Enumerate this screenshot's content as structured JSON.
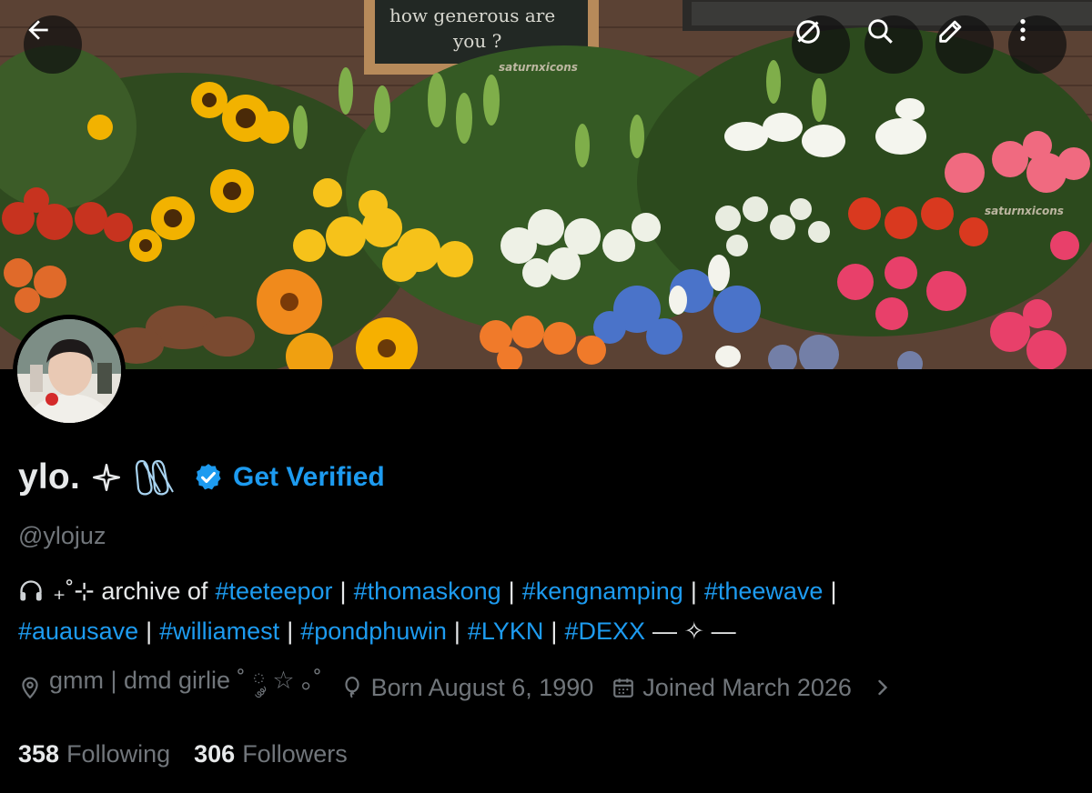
{
  "banner": {
    "chalkboard_text": [
      "how generous are",
      "you ?"
    ],
    "watermark": "saturnxicons"
  },
  "toolbar": {
    "back_icon": "arrow-left-icon",
    "items": [
      {
        "icon": "no-eye-icon"
      },
      {
        "icon": "search-icon"
      },
      {
        "icon": "edit-icon"
      },
      {
        "icon": "more-vertical-icon"
      }
    ]
  },
  "profile": {
    "display_name": "ylo.",
    "name_symbol": "✧",
    "get_verified_label": "Get Verified",
    "handle": "@ylojuz",
    "bio": {
      "line1_prefix": "₊˚⊹ archive of",
      "line1_tags": [
        "#teeteepor",
        "#thomaskong",
        "#kengnamping",
        "#theewave"
      ],
      "line2_tags": [
        "#auausave",
        "#williamest",
        "#pondphuwin",
        "#LYKN",
        "#DEXX"
      ],
      "line2_suffix": "— ✧ —"
    },
    "location": "gmm | dmd girlie ˚ ༘ ☆ ｡˚",
    "birthday": "Born August 6, 1990",
    "joined": "Joined March 2026"
  },
  "stats": {
    "following_count": "358",
    "following_label": "Following",
    "followers_count": "306",
    "followers_label": "Followers"
  },
  "colors": {
    "accent": "#1d9bf0",
    "text_primary": "#e7e9ea",
    "text_secondary": "#71767b",
    "background": "#000000"
  }
}
